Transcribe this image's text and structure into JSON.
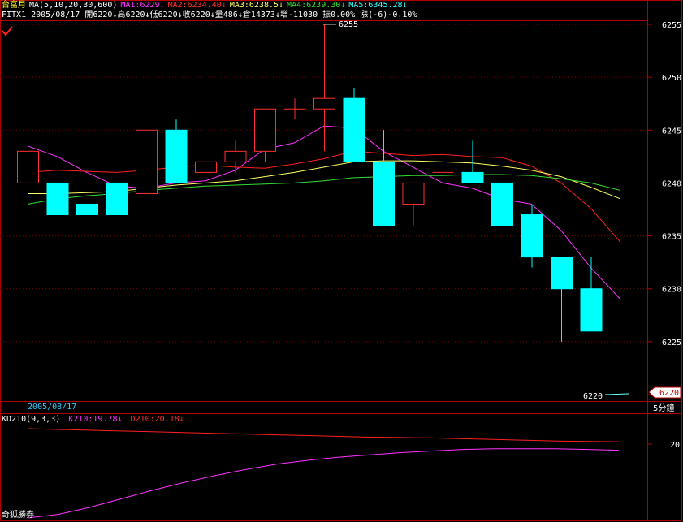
{
  "header": {
    "title": "台富月",
    "ma_periods": "MA(5,10,20,30,600)",
    "ma1": "MA1:6229↓",
    "ma2": "MA2:6234.40↓",
    "ma3": "MA3:6238.5↓",
    "ma4": "MA4:6239.30↓",
    "ma5": "MA5:6345.28↓",
    "line2": "FITX1 2005/08/17 開6220↓高6220↓低6220↓收6220↓量486↓倉14373↓增-11030 振0.00% 漲(-6)-0.10%"
  },
  "colors": {
    "background": "#000000",
    "frame": "#b00000",
    "up_candle": "#ff3030",
    "down_candle": "#00ffff",
    "ma1": "#ff33ff",
    "ma2": "#ff2020",
    "ma3": "#ffff66",
    "ma4": "#33dd33",
    "k_line": "#ff33ff",
    "d_line": "#ff2020",
    "text_white": "#ffffff",
    "text_cyan": "#33ffff"
  },
  "chart_data": {
    "type": "candlestick",
    "ylim": [
      6218,
      6257
    ],
    "y_ticks": [
      "6255",
      "6250",
      "6245",
      "6240",
      "6235",
      "6230",
      "6225",
      "6220"
    ],
    "max_label": "6255",
    "last_price_label": "6220",
    "candles": [
      {
        "o": 6240,
        "h": 6243,
        "l": 6240,
        "c": 6243
      },
      {
        "o": 6240,
        "h": 6240,
        "l": 6237,
        "c": 6237
      },
      {
        "o": 6238,
        "h": 6238,
        "l": 6237,
        "c": 6237
      },
      {
        "o": 6240,
        "h": 6240,
        "l": 6237,
        "c": 6237
      },
      {
        "o": 6239,
        "h": 6245,
        "l": 6239,
        "c": 6245
      },
      {
        "o": 6245,
        "h": 6246,
        "l": 6240,
        "c": 6240
      },
      {
        "o": 6241,
        "h": 6242,
        "l": 6241,
        "c": 6242
      },
      {
        "o": 6242,
        "h": 6244,
        "l": 6241,
        "c": 6243
      },
      {
        "o": 6243,
        "h": 6247,
        "l": 6242,
        "c": 6247
      },
      {
        "o": 6247,
        "h": 6248,
        "l": 6246,
        "c": 6247
      },
      {
        "o": 6247,
        "h": 6255,
        "l": 6243,
        "c": 6248
      },
      {
        "o": 6248,
        "h": 6249,
        "l": 6242,
        "c": 6242
      },
      {
        "o": 6242,
        "h": 6245,
        "l": 6236,
        "c": 6236
      },
      {
        "o": 6238,
        "h": 6240,
        "l": 6236,
        "c": 6240
      },
      {
        "o": 6241,
        "h": 6245,
        "l": 6238,
        "c": 6241
      },
      {
        "o": 6241,
        "h": 6244,
        "l": 6240,
        "c": 6240
      },
      {
        "o": 6240,
        "h": 6240,
        "l": 6236,
        "c": 6236
      },
      {
        "o": 6237,
        "h": 6238,
        "l": 6232,
        "c": 6233
      },
      {
        "o": 6233,
        "h": 6233,
        "l": 6225,
        "c": 6230
      },
      {
        "o": 6230,
        "h": 6233,
        "l": 6226,
        "c": 6226
      }
    ],
    "ma_lines": [
      {
        "name": "MA1",
        "values": [
          6243.5,
          6242.5,
          6241,
          6239.7,
          6239.5,
          6240,
          6240.2,
          6241.2,
          6243.2,
          6243.8,
          6245.4,
          6245.2,
          6243,
          6241.5,
          6240,
          6239.5,
          6238.5,
          6238,
          6235.5,
          6232,
          6229
        ]
      },
      {
        "name": "MA2",
        "values": [
          6241,
          6241.2,
          6241.1,
          6241,
          6241.2,
          6241.5,
          6241.7,
          6241.5,
          6241.4,
          6241.8,
          6242.3,
          6243,
          6242.8,
          6242.6,
          6242.7,
          6242.5,
          6242.4,
          6241.6,
          6240,
          6237.6,
          6234.4
        ]
      },
      {
        "name": "MA3",
        "values": [
          6239,
          6239,
          6239.1,
          6239.2,
          6239.5,
          6239.8,
          6240,
          6240.2,
          6240.6,
          6241,
          6241.5,
          6242,
          6242.1,
          6242.1,
          6242,
          6241.9,
          6241.6,
          6241.2,
          6240.6,
          6239.6,
          6238.5
        ]
      },
      {
        "name": "MA4",
        "values": [
          6238,
          6238.5,
          6238.8,
          6239,
          6239.3,
          6239.5,
          6239.7,
          6239.8,
          6239.9,
          6240,
          6240.2,
          6240.5,
          6240.6,
          6240.7,
          6240.7,
          6240.8,
          6240.8,
          6240.7,
          6240.4,
          6240,
          6239.3
        ]
      }
    ],
    "sub_chart": {
      "date_label": "2005/08/17",
      "title": "KD210(9,3,3)",
      "k_label": "K210:19.78↓",
      "d_label": "D210:20.18↓",
      "period_label": "5分鐘",
      "ylim": [
        10,
        21
      ],
      "y_tick": "20",
      "k_values": [
        10.2,
        10.9,
        11.8,
        12.9,
        14.0,
        15.0,
        15.9,
        16.7,
        17.4,
        17.9,
        18.3,
        18.6,
        18.9,
        19.1,
        19.3,
        19.4,
        19.4,
        19.4,
        19.3,
        19.2
      ],
      "d_values": [
        22.0,
        21.9,
        21.8,
        21.7,
        21.6,
        21.5,
        21.4,
        21.3,
        21.2,
        21.1,
        21.0,
        20.9,
        20.85,
        20.8,
        20.7,
        20.6,
        20.5,
        20.4,
        20.35,
        20.3
      ]
    }
  },
  "footer": {
    "brand": "奇狐勝券"
  }
}
